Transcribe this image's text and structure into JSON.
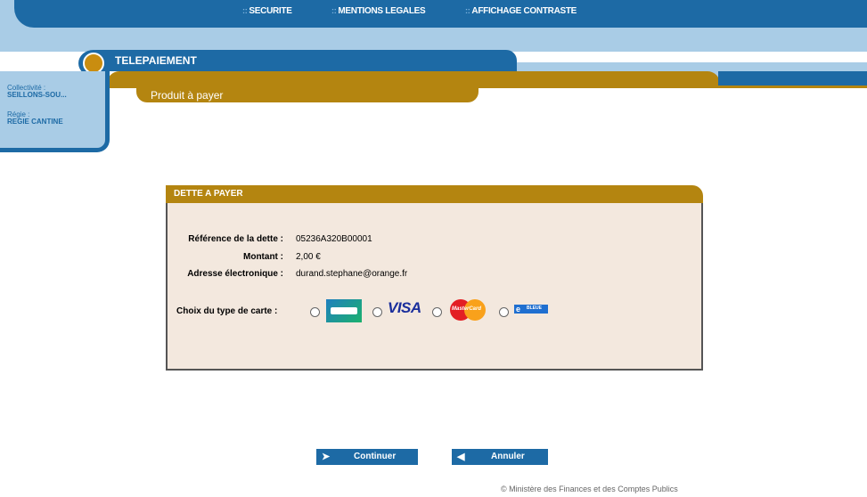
{
  "topnav": {
    "links": [
      "SECURITE",
      "MENTIONS LEGALES",
      "AFFICHAGE CONTRASTE"
    ]
  },
  "header": {
    "title": "TELEPAIEMENT",
    "subtab": "Produit à payer"
  },
  "sidebar": {
    "collectivite_label": "Collectivité :",
    "collectivite_value": "SEILLONS-SOU...",
    "regie_label": "Régie :",
    "regie_value": "REGIE CANTINE"
  },
  "dette": {
    "title": "DETTE A PAYER",
    "reference_label": "Référence de la dette :",
    "reference_value": "05236A320B00001",
    "montant_label": "Montant :",
    "montant_value": "2,00 €",
    "email_label": "Adresse électronique :",
    "email_value": "durand.stephane@orange.fr",
    "card_choice_label": "Choix du type de carte :",
    "cards": {
      "cb_icon": "cb-card-icon",
      "visa_text": "VISA",
      "mastercard_text": "MasterCard",
      "ebleue_text": "BLEUE",
      "ebleue_prefix": "e"
    }
  },
  "buttons": {
    "continue_label": "Continuer",
    "cancel_label": "Annuler"
  },
  "footer": {
    "text": "© Ministère des Finances et des Comptes Publics"
  },
  "colors": {
    "primary_blue": "#1d6aa5",
    "light_blue": "#a9cce6",
    "gold": "#b48510",
    "panel_bg": "#f3e8de"
  }
}
